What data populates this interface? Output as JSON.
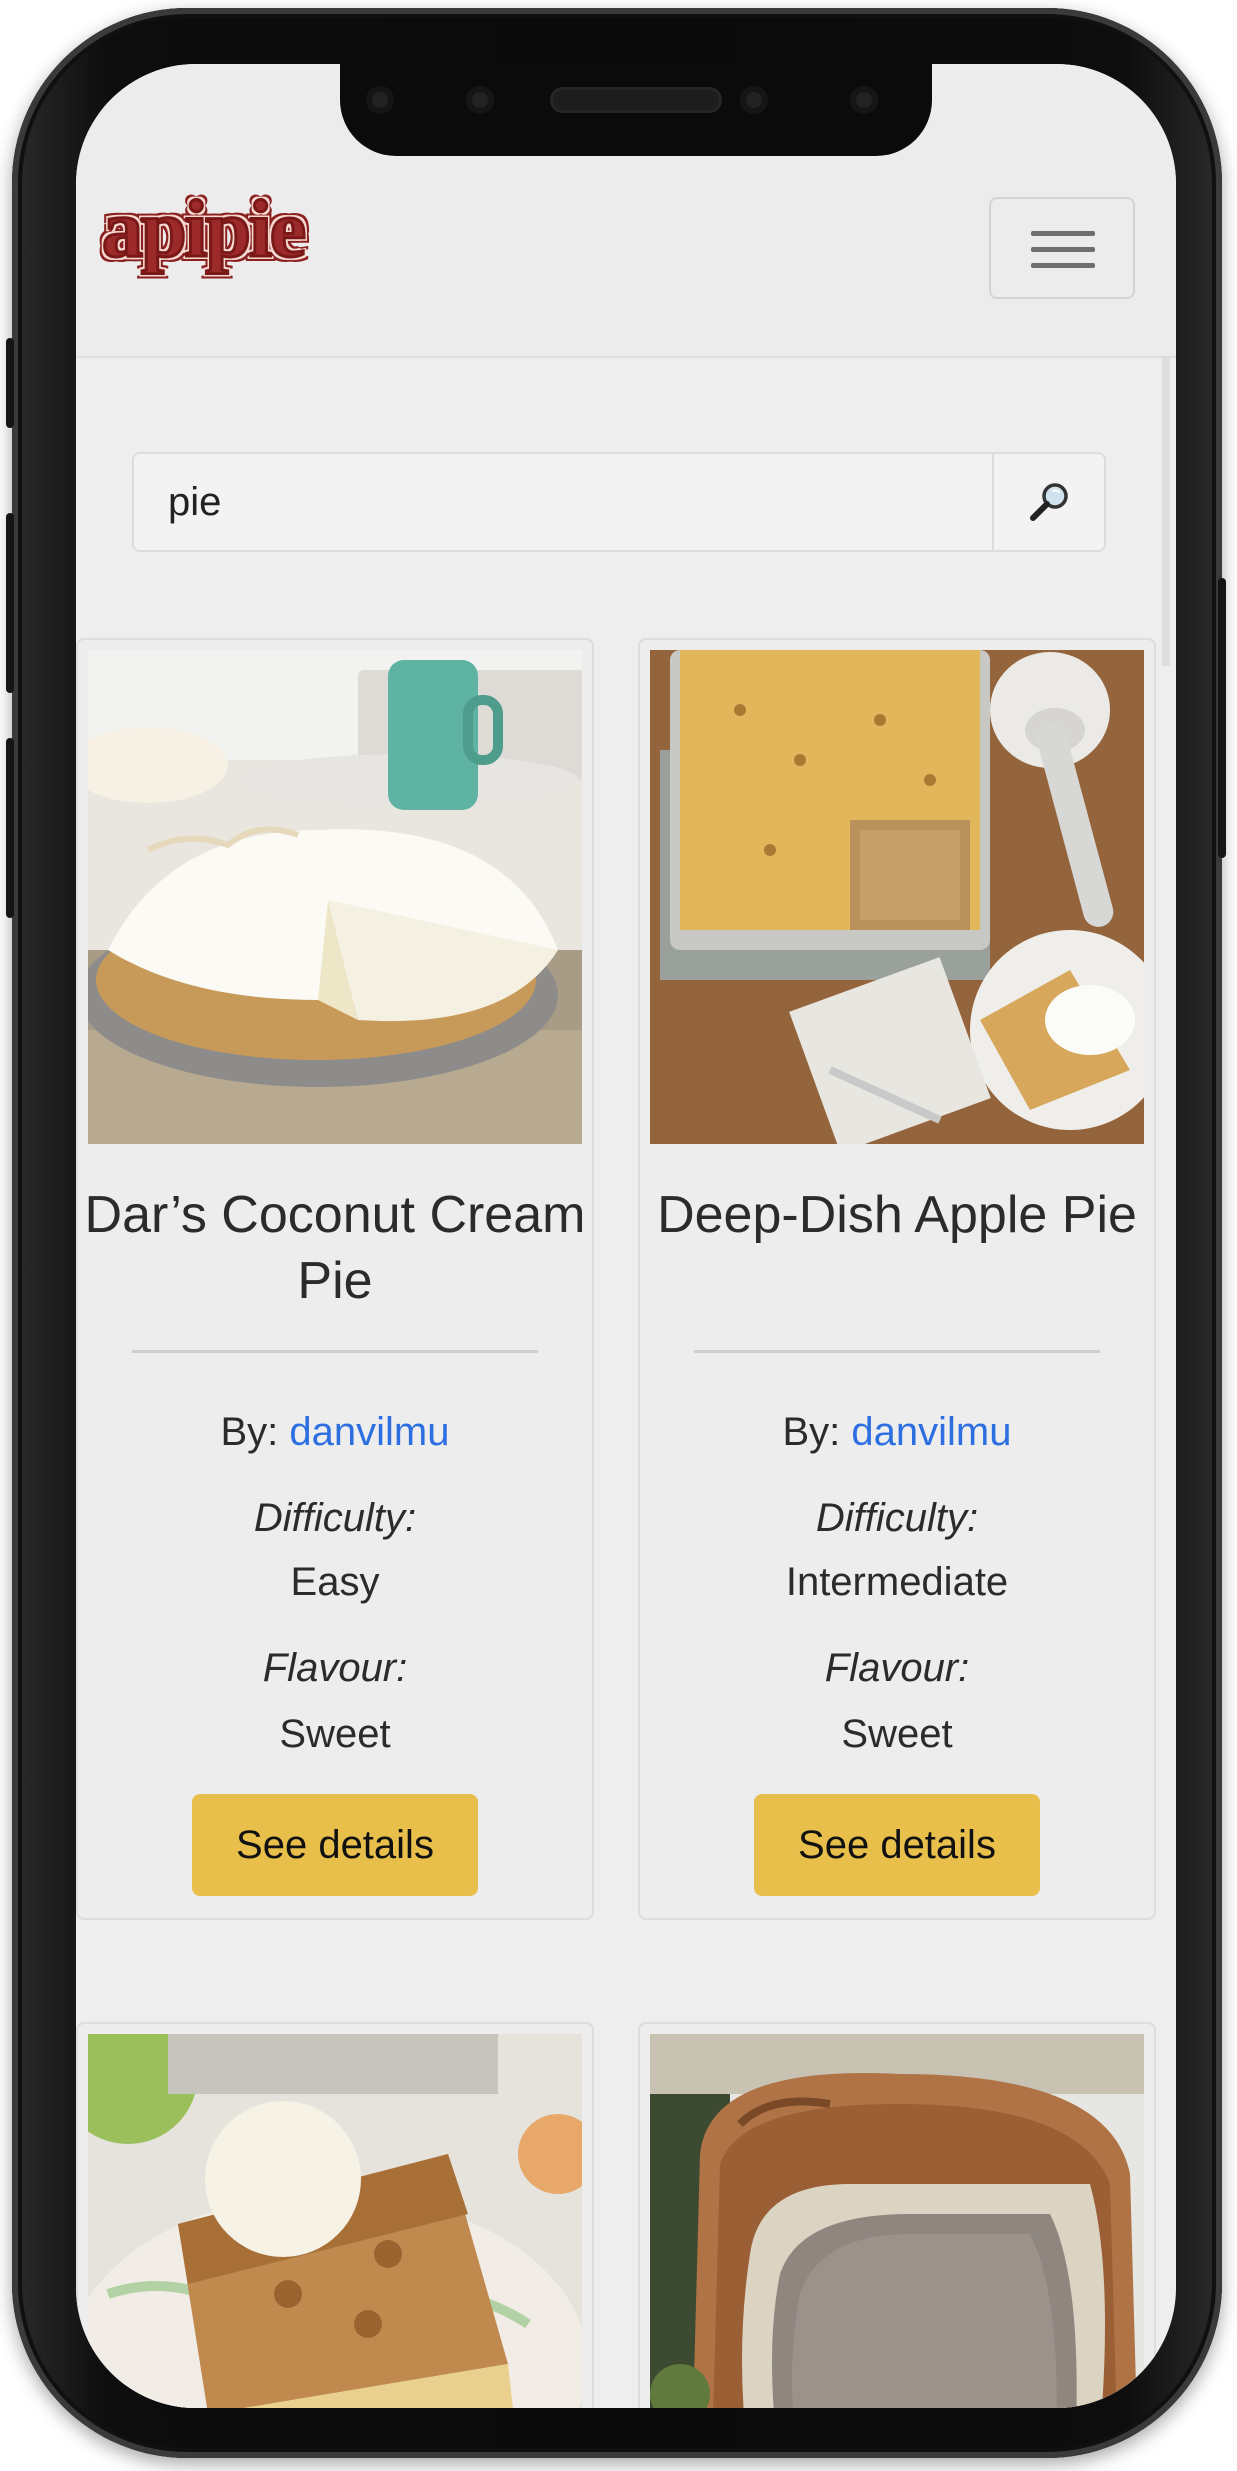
{
  "brand": {
    "logo_text": "apipie"
  },
  "search": {
    "value": "pie",
    "button_icon": "search-icon"
  },
  "recipes": [
    {
      "title": "Dar’s Coconut Cream Pie",
      "by_label": "By:",
      "author": "danvilmu",
      "difficulty_label": "Difficulty:",
      "difficulty": "Easy",
      "flavour_label": "Flavour:",
      "flavour": "Sweet",
      "button": "See details"
    },
    {
      "title": "Deep-Dish Apple Pie",
      "by_label": "By:",
      "author": "danvilmu",
      "difficulty_label": "Difficulty:",
      "difficulty": "Intermediate",
      "flavour_label": "Flavour:",
      "flavour": "Sweet",
      "button": "See details"
    }
  ],
  "colors": {
    "logo": "#9c2a2a",
    "accent_button": "#e8bf4a",
    "link": "#2d6fe0",
    "background": "#eeeeee"
  }
}
